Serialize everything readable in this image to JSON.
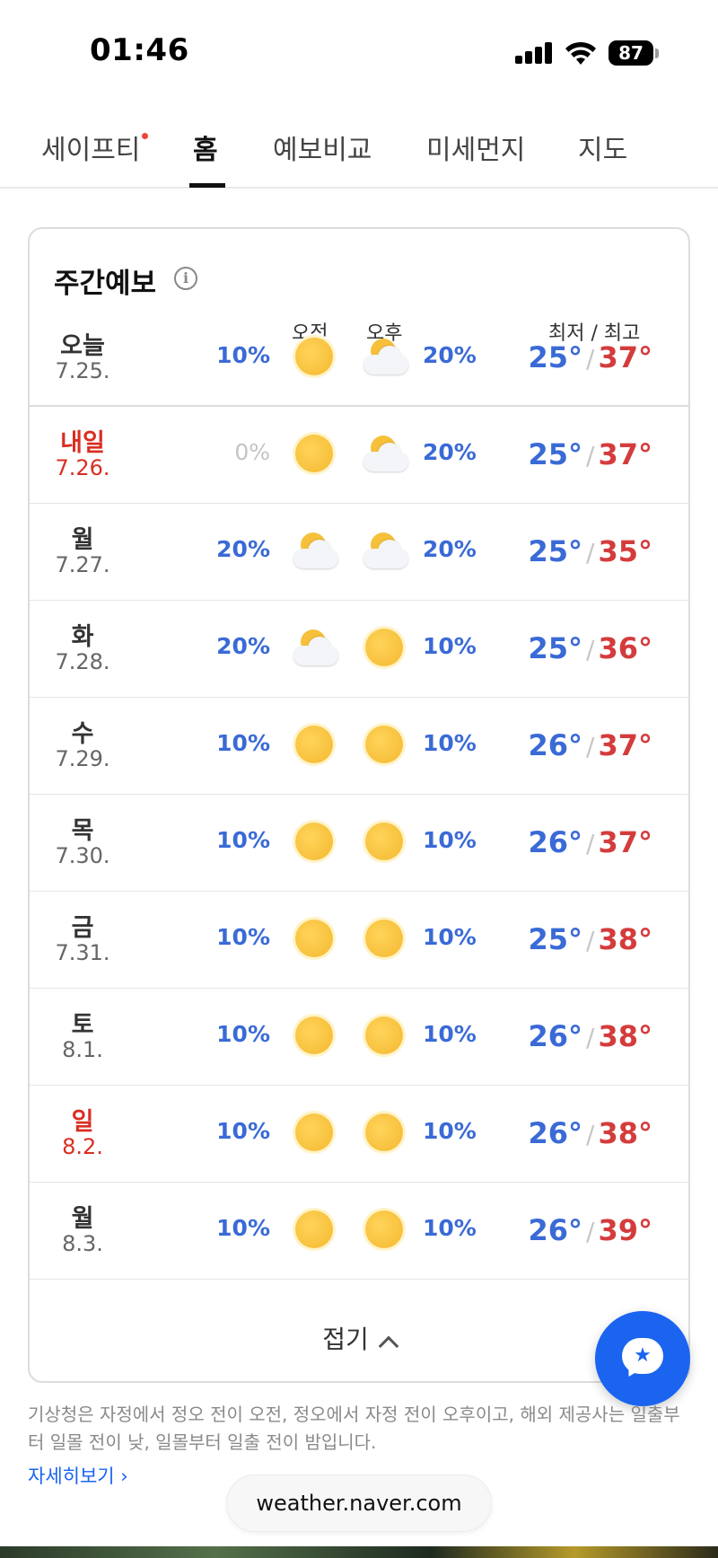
{
  "status_bar": {
    "time": "01:46",
    "battery": "87"
  },
  "tabs": [
    {
      "label": "세이프티",
      "has_dot": true
    },
    {
      "label": "홈",
      "active": true
    },
    {
      "label": "예보비교"
    },
    {
      "label": "미세먼지"
    },
    {
      "label": "지도"
    }
  ],
  "card": {
    "title": "주간예보",
    "col_am": "오전",
    "col_pm": "오후",
    "col_temp": "최저 / 최고",
    "rows": [
      {
        "day": "오늘",
        "date": "7.25.",
        "am_rain": "10%",
        "am_icon": "sun",
        "pm_icon": "cloud-sun",
        "pm_rain": "20%",
        "low": "25°",
        "high": "37°"
      },
      {
        "day": "내일",
        "date": "7.26.",
        "am_rain": "0%",
        "am_icon": "sun",
        "pm_icon": "cloud-sun",
        "pm_rain": "20%",
        "low": "25°",
        "high": "37°",
        "holiday": true
      },
      {
        "day": "월",
        "date": "7.27.",
        "am_rain": "20%",
        "am_icon": "cloud-sun",
        "pm_icon": "cloud-sun",
        "pm_rain": "20%",
        "low": "25°",
        "high": "35°"
      },
      {
        "day": "화",
        "date": "7.28.",
        "am_rain": "20%",
        "am_icon": "cloud-sun",
        "pm_icon": "sun",
        "pm_rain": "10%",
        "low": "25°",
        "high": "36°"
      },
      {
        "day": "수",
        "date": "7.29.",
        "am_rain": "10%",
        "am_icon": "sun",
        "pm_icon": "sun",
        "pm_rain": "10%",
        "low": "26°",
        "high": "37°"
      },
      {
        "day": "목",
        "date": "7.30.",
        "am_rain": "10%",
        "am_icon": "sun",
        "pm_icon": "sun",
        "pm_rain": "10%",
        "low": "26°",
        "high": "37°"
      },
      {
        "day": "금",
        "date": "7.31.",
        "am_rain": "10%",
        "am_icon": "sun",
        "pm_icon": "sun",
        "pm_rain": "10%",
        "low": "25°",
        "high": "38°"
      },
      {
        "day": "토",
        "date": "8.1.",
        "am_rain": "10%",
        "am_icon": "sun",
        "pm_icon": "sun",
        "pm_rain": "10%",
        "low": "26°",
        "high": "38°"
      },
      {
        "day": "일",
        "date": "8.2.",
        "am_rain": "10%",
        "am_icon": "sun",
        "pm_icon": "sun",
        "pm_rain": "10%",
        "low": "26°",
        "high": "38°",
        "holiday": true
      },
      {
        "day": "월",
        "date": "8.3.",
        "am_rain": "10%",
        "am_icon": "sun",
        "pm_icon": "sun",
        "pm_rain": "10%",
        "low": "26°",
        "high": "39°"
      }
    ],
    "temp_separator": "/",
    "fold_label": "접기"
  },
  "note": "기상청은 자정에서 정오 전이 오전, 정오에서 자정 전이 오후이고, 해외 제공사는 일출부터 일몰 전이 낮, 일몰부터 일출 전이 밤입니다.",
  "more_link": "자세히보기 ›",
  "url": "weather.naver.com",
  "colors": {
    "low_temp": "#3a6ad6",
    "high_temp": "#d43c3c",
    "holiday": "#d92e22",
    "fab": "#1a64f0"
  }
}
